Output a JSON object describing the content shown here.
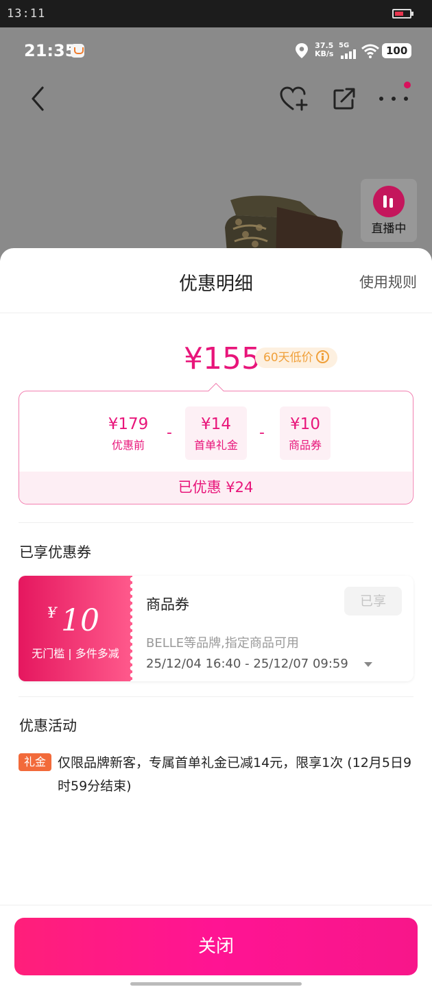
{
  "system_bar": {
    "time": "13:11"
  },
  "phone_status": {
    "time": "21:35",
    "speed": "37.5",
    "speed_unit": "KB/s",
    "network": "5G",
    "battery": "100"
  },
  "live_badge": {
    "label": "直播中"
  },
  "sheet": {
    "title": "优惠明细",
    "rules_link": "使用规则"
  },
  "price": {
    "final": "¥155",
    "low_tag": "60天低价"
  },
  "calc": {
    "items": [
      {
        "amount": "¥179",
        "label": "优惠前"
      },
      {
        "amount": "¥14",
        "label": "首单礼金"
      },
      {
        "amount": "¥10",
        "label": "商品券"
      }
    ],
    "minus": "-",
    "saved": "已优惠 ¥24"
  },
  "coupons_section": {
    "title": "已享优惠券",
    "coupon": {
      "yen": "¥",
      "value": "10",
      "condition": "无门槛 | 多件多减",
      "name": "商品券",
      "status": "已享",
      "description": "BELLE等品牌,指定商品可用",
      "validity": "25/12/04 16:40 - 25/12/07 09:59"
    }
  },
  "activities_section": {
    "title": "优惠活动",
    "tag": "礼金",
    "text": "仅限品牌新客，专属首单礼金已减14元，限享1次 (12月5日9时59分结束)"
  },
  "close_button": "关闭",
  "colors": {
    "accent": "#e8157a",
    "button": "#ff1f7a",
    "promo_tag": "#f26a3a",
    "low_tag": "#f0a03a"
  }
}
